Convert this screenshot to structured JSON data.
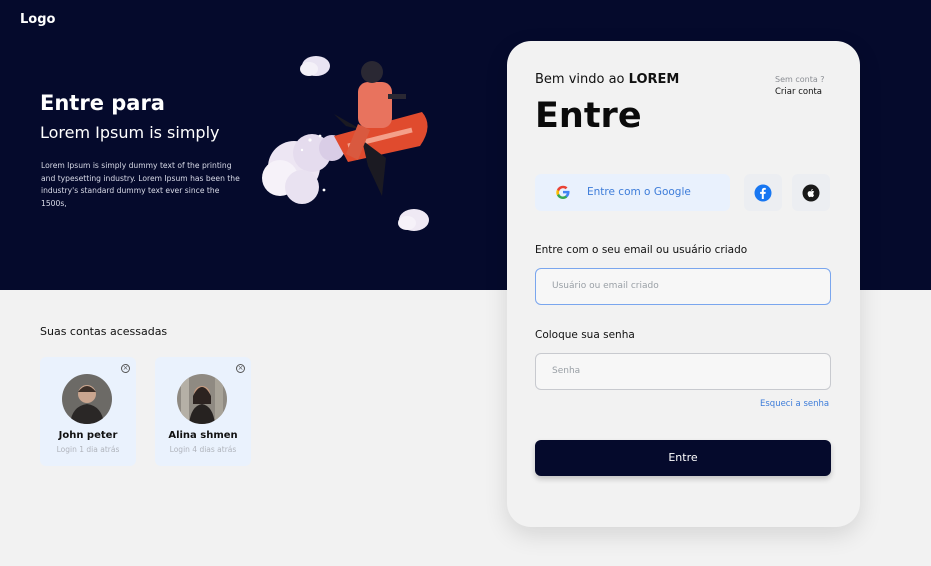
{
  "logo": "Logo",
  "hero": {
    "title": "Entre para",
    "subtitle": "Lorem Ipsum is simply",
    "description": "Lorem Ipsum is simply dummy text of the printing and typesetting industry. Lorem Ipsum has been the industry's standard dummy text ever since the 1500s,"
  },
  "accounts": {
    "title": "Suas contas acessadas",
    "items": [
      {
        "name": "John peter",
        "time": "Login 1 dia atrás"
      },
      {
        "name": "Alina shmen",
        "time": "Login 4 dias atrás"
      }
    ]
  },
  "login": {
    "welcome_prefix": "Bem vindo ao ",
    "welcome_brand": "LOREM",
    "title": "Entre",
    "no_account": "Sem conta ?",
    "signup_link": "Criar conta",
    "google_label": "Entre com o Google",
    "user_label": "Entre com o seu email ou usuário criado",
    "user_placeholder": "Usuário ou email criado",
    "password_label": "Coloque sua senha",
    "password_placeholder": "Senha",
    "forgot": "Esqueci a senha",
    "submit": "Entre"
  },
  "colors": {
    "hero_bg": "#050a2c",
    "accent_blue": "#3d7cd9",
    "submit_bg": "#050a2c"
  }
}
